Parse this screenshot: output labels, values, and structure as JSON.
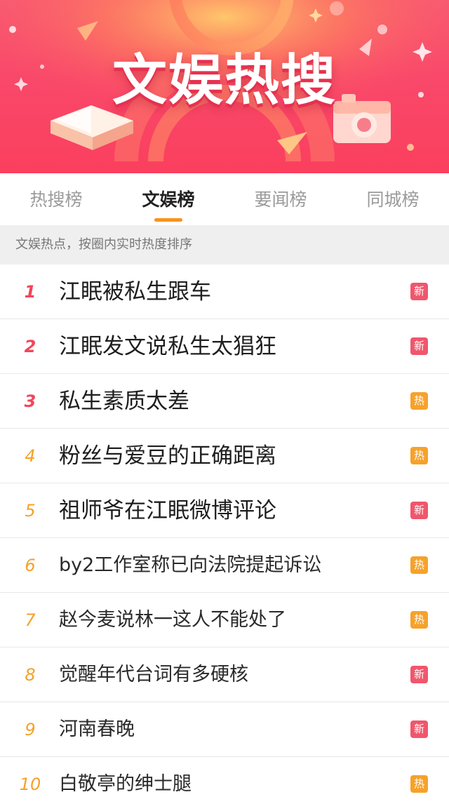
{
  "banner": {
    "title": "文娱热搜"
  },
  "tabs": [
    {
      "label": "热搜榜",
      "active": false
    },
    {
      "label": "文娱榜",
      "active": true
    },
    {
      "label": "要闻榜",
      "active": false
    },
    {
      "label": "同城榜",
      "active": false
    }
  ],
  "subtitle": "文娱热点，按圈内实时热度排序",
  "colors": {
    "accent": "#f7931e",
    "rank_top": "#f2465a",
    "rank_rest": "#f5a12a",
    "badge_new": "#f0566c",
    "badge_hot": "#f6a22a"
  },
  "items": [
    {
      "rank": "1",
      "title": "江眠被私生跟车",
      "badge": "新",
      "badge_type": "new"
    },
    {
      "rank": "2",
      "title": "江眠发文说私生太猖狂",
      "badge": "新",
      "badge_type": "new"
    },
    {
      "rank": "3",
      "title": "私生素质太差",
      "badge": "热",
      "badge_type": "hot"
    },
    {
      "rank": "4",
      "title": "粉丝与爱豆的正确距离",
      "badge": "热",
      "badge_type": "hot"
    },
    {
      "rank": "5",
      "title": "祖师爷在江眠微博评论",
      "badge": "新",
      "badge_type": "new"
    },
    {
      "rank": "6",
      "title": "by2工作室称已向法院提起诉讼",
      "badge": "热",
      "badge_type": "hot"
    },
    {
      "rank": "7",
      "title": "赵今麦说林一这人不能处了",
      "badge": "热",
      "badge_type": "hot"
    },
    {
      "rank": "8",
      "title": "觉醒年代台词有多硬核",
      "badge": "新",
      "badge_type": "new"
    },
    {
      "rank": "9",
      "title": "河南春晚",
      "badge": "新",
      "badge_type": "new"
    },
    {
      "rank": "10",
      "title": "白敬亭的绅士腿",
      "badge": "热",
      "badge_type": "hot"
    }
  ]
}
